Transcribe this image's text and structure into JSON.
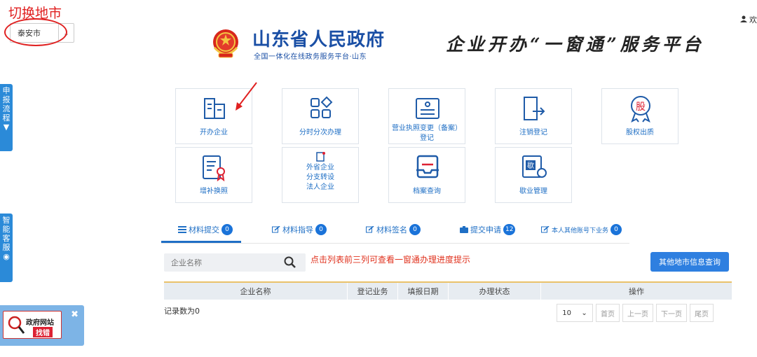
{
  "city_switch": {
    "annotation": "切换地市",
    "selected": "泰安市"
  },
  "header": {
    "gov_name": "山东省人民政府",
    "gov_subtitle": "全国一体化在线政务服务平台·山东",
    "platform_title": "企业开办“一窗通”服务平台",
    "welcome": "欢"
  },
  "side": {
    "flow_tab": [
      "申",
      "报",
      "流",
      "程"
    ],
    "ai_tab": [
      "智",
      "能",
      "客",
      "服"
    ]
  },
  "report_widget": {
    "line1": "政府网站",
    "line2": "找错"
  },
  "tiles": [
    {
      "label": "开办企业",
      "icon": "building-icon"
    },
    {
      "label": "分时分次办理",
      "icon": "grid-diamond-icon"
    },
    {
      "label": "营业执照变更（备案）登记",
      "icon": "license-icon"
    },
    {
      "label": "注销登记",
      "icon": "exit-door-icon"
    },
    {
      "label": "股权出质",
      "icon": "stock-seal-icon"
    },
    {
      "label": "增补换照",
      "icon": "certificate-icon"
    },
    {
      "label": "外省企业\n分支转设\n法人企业",
      "icon": "transfer-icon"
    },
    {
      "label": "档案查询",
      "icon": "archive-icon"
    },
    {
      "label": "歇业管理",
      "icon": "pause-business-icon"
    }
  ],
  "tabs": [
    {
      "label": "材料提交",
      "count": "0"
    },
    {
      "label": "材料指导",
      "count": "0"
    },
    {
      "label": "材料签名",
      "count": "0"
    },
    {
      "label": "提交申请",
      "count": "12"
    },
    {
      "label": "本人其他账号下业务",
      "count": "0"
    }
  ],
  "search": {
    "placeholder": "企业名称",
    "hint": "点击列表前三列可查看一窗通办理进度提示",
    "other_button": "其他地市信息查询"
  },
  "table": {
    "columns": [
      "企业名称",
      "登记业务",
      "填报日期",
      "办理状态",
      "操作"
    ],
    "records_text": "记录数为0"
  },
  "pager": {
    "page_size": "10",
    "first": "首页",
    "prev": "上一页",
    "next": "下一页",
    "last": "尾页"
  },
  "colors": {
    "brand_blue": "#1a4fa5",
    "link_blue": "#1f6fc5",
    "button_blue": "#2e7fe0",
    "alert_red": "#e0321e"
  }
}
